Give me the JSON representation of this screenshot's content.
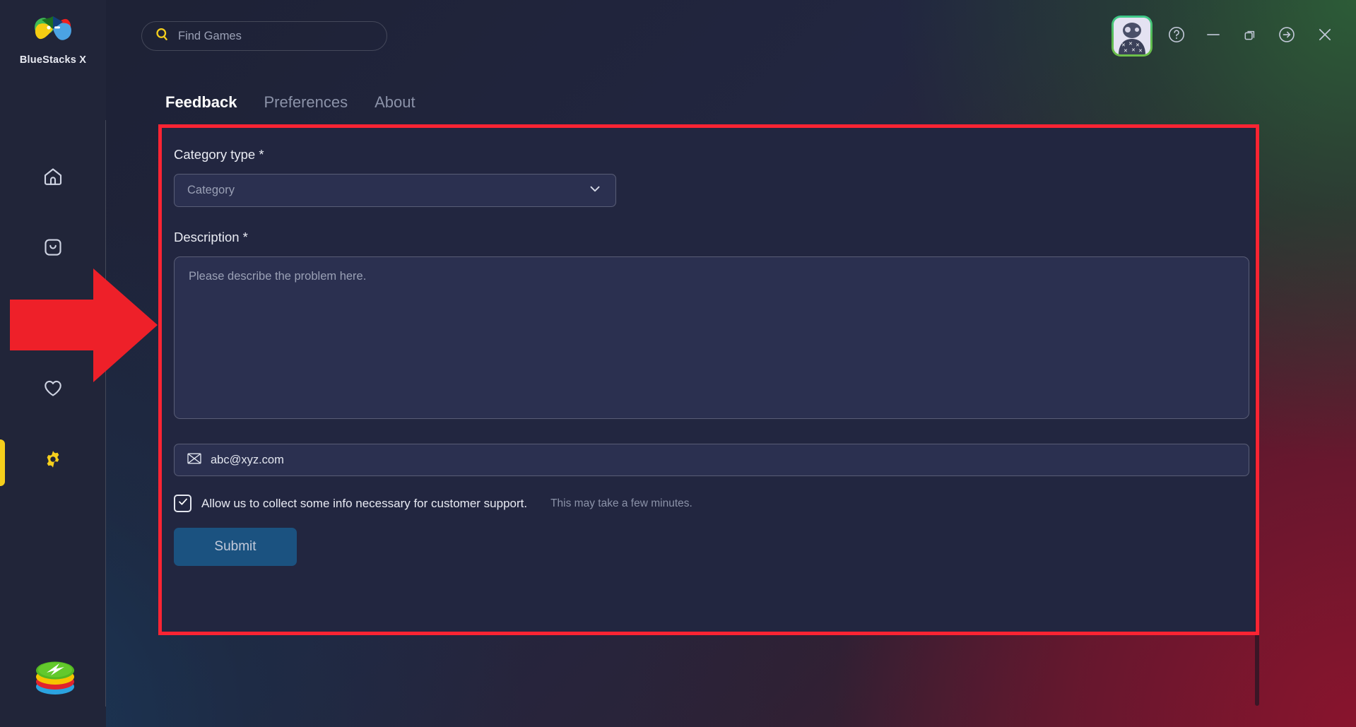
{
  "app": {
    "brand_name": "BlueStacks X",
    "brand_logo_icon": "bluestacks-x-petals-logo",
    "bottom_logo_icon": "bluestacks-stack-logo"
  },
  "search": {
    "icon": "search-icon",
    "placeholder": "Find Games"
  },
  "window_controls": {
    "avatar_icon": "user-avatar",
    "help_label": "?",
    "help_icon": "help-circle-icon",
    "minimize_icon": "minimize-icon",
    "maximize_icon": "maximize-restore-icon",
    "arrow_icon": "arrow-right-circle-icon",
    "close_icon": "close-icon"
  },
  "sidebar": {
    "items": [
      {
        "name": "home",
        "icon": "home-icon",
        "active": false
      },
      {
        "name": "app-center",
        "icon": "app-drawer-icon",
        "active": false
      },
      {
        "name": "favorites",
        "icon": "heart-icon",
        "active": false
      },
      {
        "name": "settings",
        "icon": "gear-icon",
        "active": true
      }
    ],
    "active_indicator_color": "#f5cf1c"
  },
  "settings": {
    "tabs": [
      {
        "label": "Feedback",
        "active": true
      },
      {
        "label": "Preferences",
        "active": false
      },
      {
        "label": "About",
        "active": false
      }
    ],
    "category": {
      "label": "Category type *",
      "placeholder": "Category",
      "chevron_icon": "chevron-down-icon"
    },
    "description": {
      "label": "Description *",
      "placeholder": "Please describe the problem here."
    },
    "email": {
      "icon": "envelope-icon",
      "value": "abc@xyz.com"
    },
    "consent": {
      "checked": true,
      "check_icon": "checkmark-icon",
      "label": "Allow us to collect some info necessary for customer support.",
      "hint": "This may take a few minutes."
    },
    "submit_label": "Submit"
  },
  "annotations": {
    "highlight_rect_color": "#fa2433",
    "arrow_icon": "right-arrow-annotation",
    "arrow_color": "#ee2029"
  },
  "colors": {
    "panel_bg": "#222640",
    "field_bg": "#2b3050",
    "sidebar_bg": "#212539",
    "accent_yellow": "#f5cf1c",
    "submit_blue": "#1b5280"
  }
}
